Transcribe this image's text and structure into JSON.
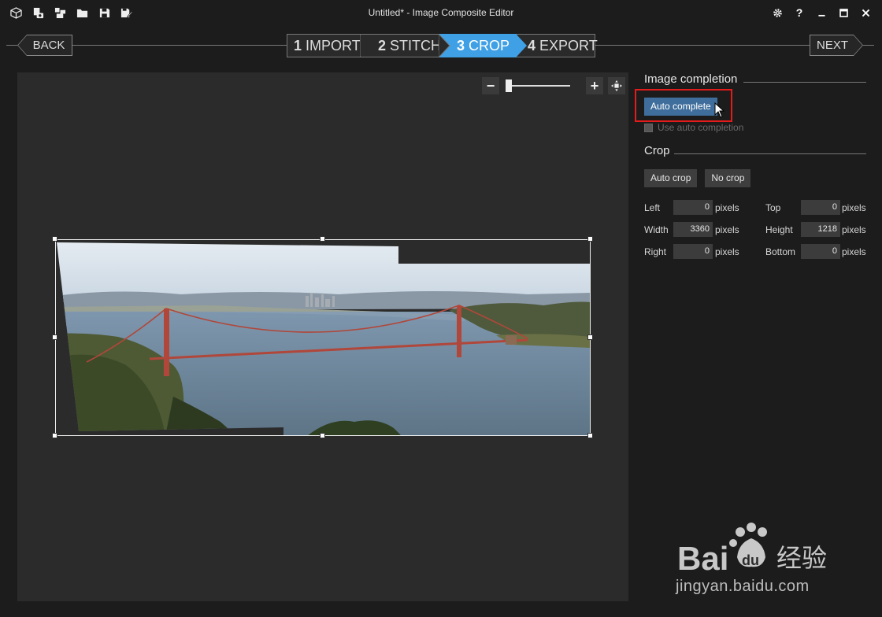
{
  "window": {
    "title": "Untitled* - Image Composite Editor"
  },
  "toolbar": {
    "icons": [
      "new-project-icon",
      "new-panorama-from-video-icon",
      "new-panorama-from-images-icon",
      "open-folder-icon",
      "save-icon",
      "save-as-icon"
    ]
  },
  "window_controls": {
    "help_label": "?"
  },
  "nav": {
    "back_label": "BACK",
    "next_label": "NEXT",
    "steps": [
      {
        "num": "1",
        "label": "IMPORT",
        "active": false
      },
      {
        "num": "2",
        "label": "STITCH",
        "active": false
      },
      {
        "num": "3",
        "label": "CROP",
        "active": true
      },
      {
        "num": "4",
        "label": "EXPORT",
        "active": false
      }
    ],
    "active_color": "#3fa0e6"
  },
  "zoom": {
    "minus_label": "−",
    "plus_label": "+",
    "level": 0.03
  },
  "panel": {
    "image_completion": {
      "title": "Image completion",
      "auto_complete_label": "Auto complete",
      "use_auto_completion_label": "Use auto completion",
      "use_auto_completion_checked": false
    },
    "crop": {
      "title": "Crop",
      "auto_crop_label": "Auto crop",
      "no_crop_label": "No crop",
      "fields": {
        "left": {
          "label": "Left",
          "value": "0",
          "unit": "pixels"
        },
        "width": {
          "label": "Width",
          "value": "3360",
          "unit": "pixels"
        },
        "right": {
          "label": "Right",
          "value": "0",
          "unit": "pixels"
        },
        "top": {
          "label": "Top",
          "value": "0",
          "unit": "pixels"
        },
        "height": {
          "label": "Height",
          "value": "1218",
          "unit": "pixels"
        },
        "bottom": {
          "label": "Bottom",
          "value": "0",
          "unit": "pixels"
        }
      }
    },
    "highlight_color": "#e21b1b"
  },
  "watermark": {
    "brand": "Bai du 经验",
    "url": "jingyan.baidu.com"
  }
}
